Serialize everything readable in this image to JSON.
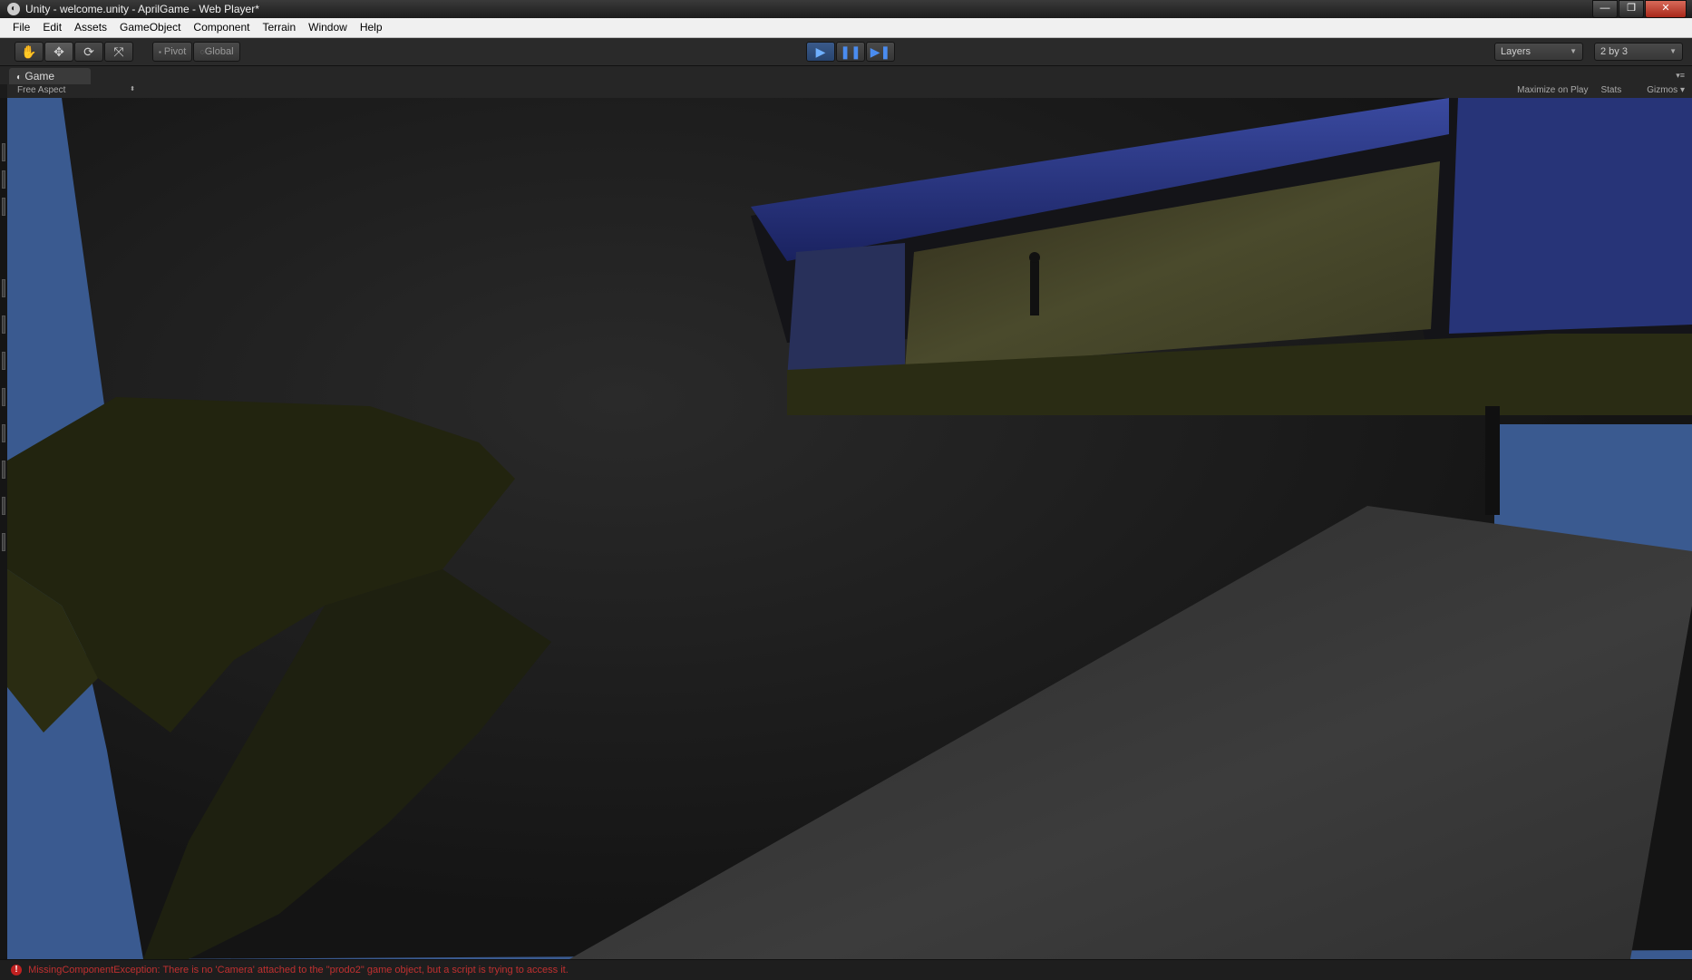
{
  "window": {
    "title": "Unity - welcome.unity - AprilGame - Web Player*",
    "buttons": {
      "minimize": "—",
      "maximize": "❐",
      "close": "✕"
    }
  },
  "menubar": {
    "items": [
      "File",
      "Edit",
      "Assets",
      "GameObject",
      "Component",
      "Terrain",
      "Window",
      "Help"
    ]
  },
  "toolbar": {
    "tools": [
      "hand-icon",
      "move-icon",
      "rotate-icon",
      "scale-icon"
    ],
    "pivot_label": "Pivot",
    "global_label": "Global",
    "play_state": "playing",
    "layers_label": "Layers",
    "layout_label": "2 by 3"
  },
  "game_panel": {
    "tab_label": "Game",
    "aspect_label": "Free Aspect",
    "maximize_label": "Maximize on Play",
    "stats_label": "Stats",
    "gizmos_label": "Gizmos"
  },
  "status": {
    "message": "MissingComponentException: There is no 'Camera' attached to the \"prodo2\" game object, but a script is trying to access it."
  },
  "colors": {
    "sky": "#3a5a90",
    "error": "#c03030",
    "play_accent": "#4a8cf0"
  }
}
